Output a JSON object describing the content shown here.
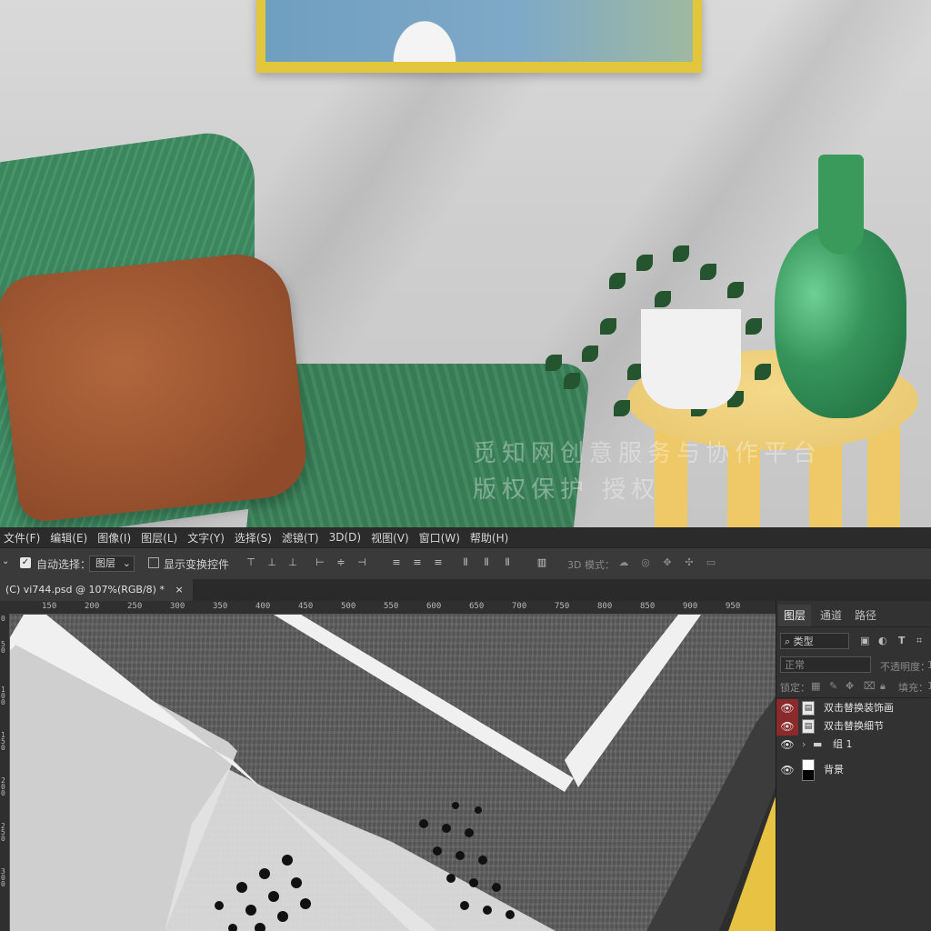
{
  "menubar": {
    "items": [
      "文件(F)",
      "编辑(E)",
      "图像(I)",
      "图层(L)",
      "文字(Y)",
      "选择(S)",
      "滤镜(T)",
      "3D(D)",
      "视图(V)",
      "窗口(W)",
      "帮助(H)"
    ]
  },
  "options": {
    "auto_select_label": "自动选择：",
    "auto_select_value": "图层",
    "show_transform_label": "显示变换控件",
    "mode_3d_label": "3D 模式："
  },
  "document": {
    "tab_title": "(C) vi744.psd @ 107%(RGB/8) *",
    "close_glyph": "×"
  },
  "ruler": {
    "h_labels": [
      "150",
      "200",
      "250",
      "300",
      "350",
      "400",
      "450",
      "500",
      "550",
      "600",
      "650",
      "700",
      "750",
      "800",
      "850",
      "900",
      "950"
    ],
    "v_labels": [
      "0",
      "50",
      "100",
      "150",
      "200",
      "250",
      "300"
    ]
  },
  "layers_panel": {
    "tabs": [
      "图层",
      "通道",
      "路径"
    ],
    "filter_label": "类型",
    "blend_mode": "正常",
    "opacity_label": "不透明度：",
    "opacity_value": "1",
    "lock_label": "锁定：",
    "fill_label": "填充：",
    "fill_value": "1",
    "layers": [
      {
        "name": "双击替换装饰画",
        "highlight": true
      },
      {
        "name": "双击替换细节",
        "highlight": true
      },
      {
        "name": "组 1",
        "highlight": false
      },
      {
        "name": "背景",
        "highlight": false
      }
    ]
  },
  "watermark": {
    "line1": "觅知网创意服务与协作平台",
    "line2": "版权保护 授权"
  },
  "colors": {
    "accent_yellow": "#e8c243",
    "layer_highlight": "#8b2a2a",
    "ui_dark": "#2b2b2b"
  }
}
